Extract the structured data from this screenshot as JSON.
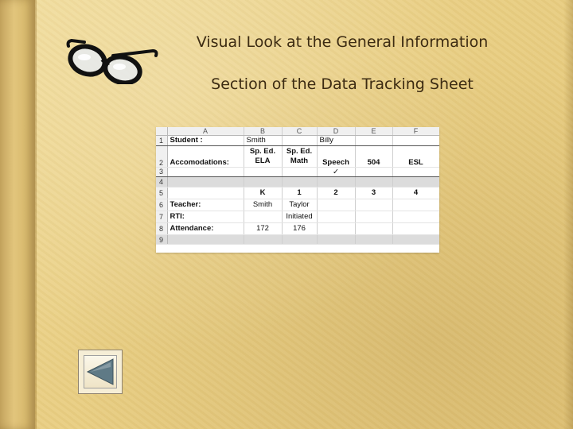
{
  "slide": {
    "title_line1": "Visual Look at the General Information",
    "title_line2": "Section of the Data Tracking Sheet"
  },
  "icons": {
    "glasses": "eyeglasses-icon",
    "back": "back-arrow-icon"
  },
  "colors": {
    "title": "#3c2b12",
    "paper": "#ecd58d",
    "back_arrow": "#5f7a86"
  },
  "spreadsheet": {
    "column_headers": [
      "",
      "A",
      "B",
      "C",
      "D",
      "E",
      "F"
    ],
    "rows": [
      {
        "num": "1",
        "cells": [
          "Student :",
          "Smith",
          "",
          "Billy",
          "",
          ""
        ]
      },
      {
        "num": "2",
        "cells": [
          "Accomodations:",
          "Sp. Ed. ELA",
          "Sp. Ed. Math",
          "Speech",
          "504",
          "ESL"
        ]
      },
      {
        "num": "3",
        "cells": [
          "",
          "",
          "",
          "✓",
          "",
          ""
        ]
      },
      {
        "num": "4",
        "cells": [
          "",
          "",
          "",
          "",
          "",
          ""
        ]
      },
      {
        "num": "5",
        "cells": [
          "",
          "K",
          "1",
          "2",
          "3",
          "4"
        ]
      },
      {
        "num": "6",
        "cells": [
          "Teacher:",
          "Smith",
          "Taylor",
          "",
          "",
          ""
        ]
      },
      {
        "num": "7",
        "cells": [
          "RTI:",
          "",
          "Initiated",
          "",
          "",
          ""
        ]
      },
      {
        "num": "8",
        "cells": [
          "Attendance:",
          "172",
          "176",
          "",
          "",
          ""
        ]
      },
      {
        "num": "9",
        "cells": [
          "",
          "",
          "",
          "",
          "",
          ""
        ]
      }
    ]
  },
  "row2_b": {
    "line1": "Sp. Ed.",
    "line2": "ELA"
  },
  "row2_c": {
    "line1": "Sp. Ed.",
    "line2": "Math"
  }
}
